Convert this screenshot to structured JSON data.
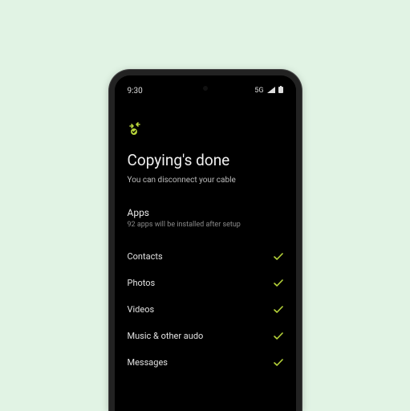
{
  "status": {
    "time": "9:30",
    "network": "5G"
  },
  "accent": "#b7d43a",
  "header": {
    "title": "Copying's done",
    "subtitle": "You can disconnect your cable"
  },
  "apps_section": {
    "title": "Apps",
    "subtitle": "92 apps will be installed after setup"
  },
  "items": [
    {
      "label": "Contacts",
      "done": true
    },
    {
      "label": "Photos",
      "done": true
    },
    {
      "label": "Videos",
      "done": true
    },
    {
      "label": "Music & other audo",
      "done": true
    },
    {
      "label": "Messages",
      "done": true
    }
  ]
}
